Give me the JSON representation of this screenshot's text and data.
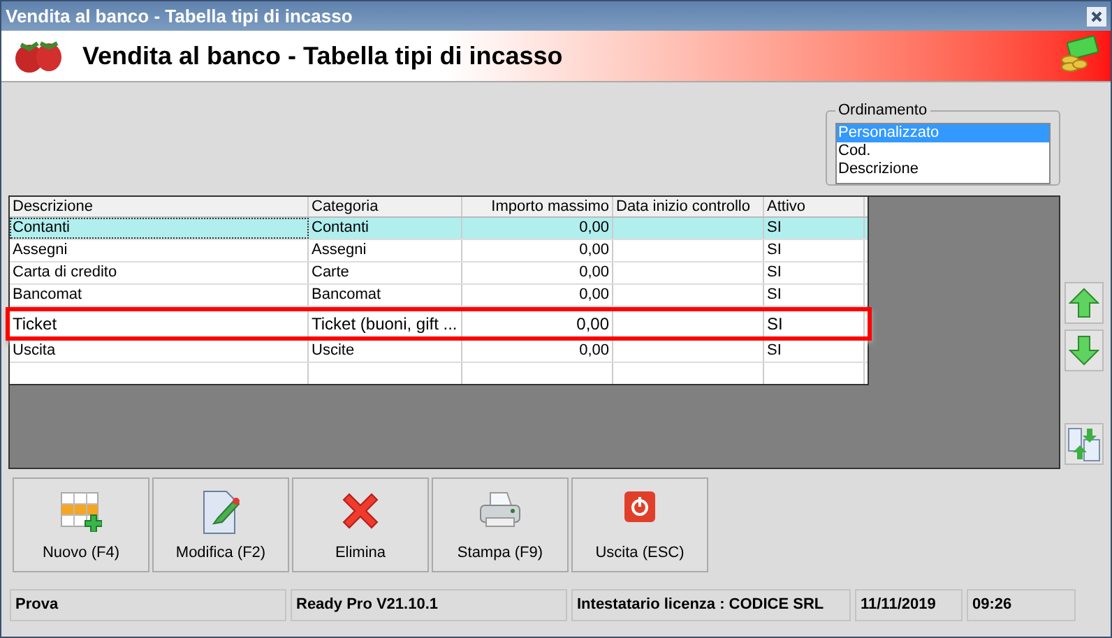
{
  "window": {
    "title": "Vendita al banco - Tabella tipi di incasso"
  },
  "header": {
    "title": "Vendita al banco - Tabella tipi di incasso"
  },
  "sort": {
    "label": "Ordinamento",
    "options": [
      {
        "label": "Personalizzato",
        "selected": true
      },
      {
        "label": "Cod.",
        "selected": false
      },
      {
        "label": "Descrizione",
        "selected": false
      }
    ]
  },
  "table": {
    "columns": [
      "Descrizione",
      "Categoria",
      "Importo massimo",
      "Data inizio controllo",
      "Attivo"
    ],
    "rows": [
      {
        "cells": [
          "Contanti",
          "Contanti",
          "0,00",
          "",
          "SI"
        ],
        "selected": true,
        "highlighted": false
      },
      {
        "cells": [
          "Assegni",
          "Assegni",
          "0,00",
          "",
          "SI"
        ],
        "selected": false,
        "highlighted": false
      },
      {
        "cells": [
          "Carta di credito",
          "Carte",
          "0,00",
          "",
          "SI"
        ],
        "selected": false,
        "highlighted": false
      },
      {
        "cells": [
          "Bancomat",
          "Bancomat",
          "0,00",
          "",
          "SI"
        ],
        "selected": false,
        "highlighted": false
      },
      {
        "cells": [
          "Ticket",
          "Ticket (buoni, gift ...",
          "0,00",
          "",
          "SI"
        ],
        "selected": false,
        "highlighted": true
      },
      {
        "cells": [
          "Uscita",
          "Uscite",
          "0,00",
          "",
          "SI"
        ],
        "selected": false,
        "highlighted": false
      }
    ]
  },
  "side_buttons": [
    {
      "kind": "up"
    },
    {
      "kind": "down"
    },
    {
      "kind": "swap"
    }
  ],
  "buttons": [
    {
      "kind": "new",
      "label": "Nuovo (F4)"
    },
    {
      "kind": "edit",
      "label": "Modifica (F2)"
    },
    {
      "kind": "delete",
      "label": "Elimina"
    },
    {
      "kind": "print",
      "label": "Stampa (F9)"
    },
    {
      "kind": "exit",
      "label": "Uscita (ESC)"
    }
  ],
  "status_bar": [
    "Prova",
    "Ready Pro V21.10.1",
    "Intestatario licenza : CODICE SRL",
    "11/11/2019",
    "09:26"
  ]
}
